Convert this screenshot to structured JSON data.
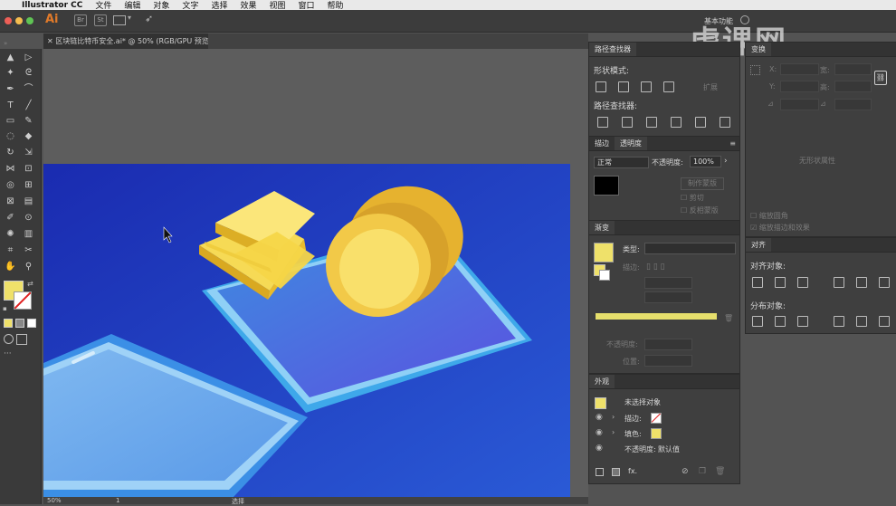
{
  "menubar": {
    "app_name": "Illustrator CC",
    "items": [
      "文件",
      "编辑",
      "对象",
      "文字",
      "选择",
      "效果",
      "视图",
      "窗口",
      "帮助"
    ]
  },
  "appbar": {
    "logo": "Ai",
    "icon1": "Br",
    "icon2": "St",
    "workspace": "基本功能"
  },
  "watermark": "虎课网",
  "document": {
    "tab_label": "区块链比特币安全.ai* @ 50% (RGB/GPU 预览)",
    "zoom": "50%",
    "artboard": "1",
    "status": "选择"
  },
  "pathfinder": {
    "tab": "路径查找器",
    "shape_modes_label": "形状模式:",
    "expand_label": "扩展",
    "pathfinders_label": "路径查找器:"
  },
  "transparency": {
    "tab_stroke": "描边",
    "tab_transparency": "透明度",
    "blend_mode": "正常",
    "opacity_label": "不透明度:",
    "opacity_value": "100%",
    "make_mask": "制作蒙版",
    "clip_label": "剪切",
    "invert_label": "反相蒙版"
  },
  "gradient": {
    "tab": "渐变",
    "type_label": "类型:",
    "stroke_label": "描边:",
    "opacity_label": "不透明度:",
    "position_label": "位置:",
    "colors": {
      "swatch": "#efe16a",
      "bar": "#e6df6c"
    }
  },
  "appearance": {
    "tab": "外观",
    "no_selection": "未选择对象",
    "stroke_label": "描边:",
    "fill_label": "填色:",
    "opacity_label": "不透明度:",
    "opacity_value": "默认值",
    "footer_fx": "fx."
  },
  "transform": {
    "tab": "变换",
    "x_label": "X:",
    "y_label": "Y:",
    "w_label": "宽:",
    "h_label": "高:",
    "no_shape": "无形状属性",
    "scale_corners": "缩放圆角",
    "scale_strokes": "缩放描边和效果"
  },
  "align": {
    "tab": "对齐",
    "align_objects": "对齐对象:",
    "distribute_objects": "分布对象:"
  },
  "colors": {
    "artboard_dark": "#1a2bb0",
    "artboard_light": "#2a8dd8",
    "coin": "#f0d34b",
    "phone_edge": "#8fc6f0",
    "fill_swatch": "#efe16a"
  }
}
